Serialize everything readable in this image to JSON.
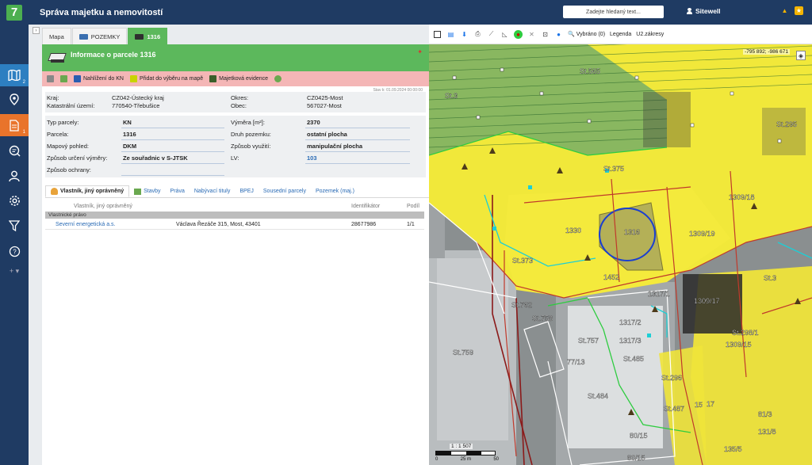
{
  "app": {
    "logo_letter": "7",
    "title": "Správa majetku a nemovitostí",
    "search_placeholder": "Zadejte hledaný text...",
    "user": "Sitewell"
  },
  "sidebar": {
    "items": [
      {
        "icon": "map-icon",
        "badge": "2"
      },
      {
        "icon": "location-pin-icon",
        "badge": ""
      },
      {
        "icon": "document-icon",
        "badge": "1"
      },
      {
        "icon": "search-document-icon",
        "badge": ""
      },
      {
        "icon": "user-icon",
        "badge": ""
      },
      {
        "icon": "gear-icon",
        "badge": ""
      },
      {
        "icon": "filter-icon",
        "badge": ""
      },
      {
        "icon": "help-icon",
        "badge": ""
      }
    ],
    "expand_label": "+ ▾"
  },
  "tabs": [
    {
      "label": "Mapa"
    },
    {
      "label": "POZEMKY"
    },
    {
      "label": "1316"
    }
  ],
  "panel": {
    "title": "Informace o parcele 1316",
    "actions": [
      {
        "label": ""
      },
      {
        "label": ""
      },
      {
        "label": "Nahlížení do KN"
      },
      {
        "label": "Přidat do výběru na mapě"
      },
      {
        "label": "Majetková evidence"
      },
      {
        "label": ""
      }
    ],
    "stamp": "Stav k: 01.09.2024 00:00:00",
    "location": {
      "kraj_label": "Kraj:",
      "kraj": "CZ042-Ústecký kraj",
      "ku_label": "Katastrální území:",
      "ku": "770540-Třebušice",
      "okres_label": "Okres:",
      "okres": "CZ0425-Most",
      "obec_label": "Obec:",
      "obec": "567027-Most"
    },
    "details": {
      "typ_label": "Typ parcely:",
      "typ": "KN",
      "parcela_label": "Parcela:",
      "parcela": "1316",
      "pohled_label": "Mapový pohled:",
      "pohled": "DKM",
      "urceni_label": "Způsob určení výměry:",
      "urceni": "Ze souřadnic v S-JTSK",
      "ochrana_label": "Způsob ochrany:",
      "ochrana": "",
      "vymera_label": "Výměra [m²]:",
      "vymera": "2370",
      "druh_label": "Druh pozemku:",
      "druh": "ostatní plocha",
      "vyuziti_label": "Způsob využití:",
      "vyuziti": "manipulační plocha",
      "lv_label": "LV:",
      "lv": "103"
    },
    "subtabs": [
      {
        "label": "Vlastník, jiný oprávněný"
      },
      {
        "label": "Stavby"
      },
      {
        "label": "Práva"
      },
      {
        "label": "Nabývací tituly"
      },
      {
        "label": "BPEJ"
      },
      {
        "label": "Sousední parcely"
      },
      {
        "label": "Pozemek (maj.)"
      }
    ],
    "table": {
      "headers": [
        "Vlastník, jiný oprávněný",
        "Identifikátor",
        "Podíl"
      ],
      "group": "Vlastnické právo",
      "rows": [
        {
          "name": "Severní energetická a.s.",
          "address": "Václava Řezáče 315, Most, 43401",
          "id": "28677986",
          "share": "1/1"
        }
      ]
    }
  },
  "map_toolbar": {
    "selected": "Vybráno (0)",
    "legend": "Legenda",
    "zakresy": "U2.zákresy"
  },
  "map": {
    "coords": "-795 892; -986 671",
    "scale": "1 : 1 507",
    "scale_labels": [
      "0",
      "25 m",
      "50"
    ],
    "labels": [
      "St.565",
      "St.3",
      "St.295",
      "St.375",
      "1309/18",
      "1330",
      "1316",
      "1309/19",
      "St.373",
      "1317/1",
      "1309/17",
      "St.762",
      "St.758",
      "1317/2",
      "1317/3",
      "St.759",
      "St.757",
      "77/13",
      "St.485",
      "St.296",
      "St.484",
      "St.487",
      "81/3",
      "80/15",
      "131/8",
      "1309/15",
      "St.298/1",
      "St.3",
      "15",
      "17",
      "80/15",
      "135/5",
      "1452"
    ]
  },
  "colors": {
    "accent_green": "#5cb85c",
    "nav_blue": "#1f3b63",
    "action_pink": "#f4b6b6"
  }
}
